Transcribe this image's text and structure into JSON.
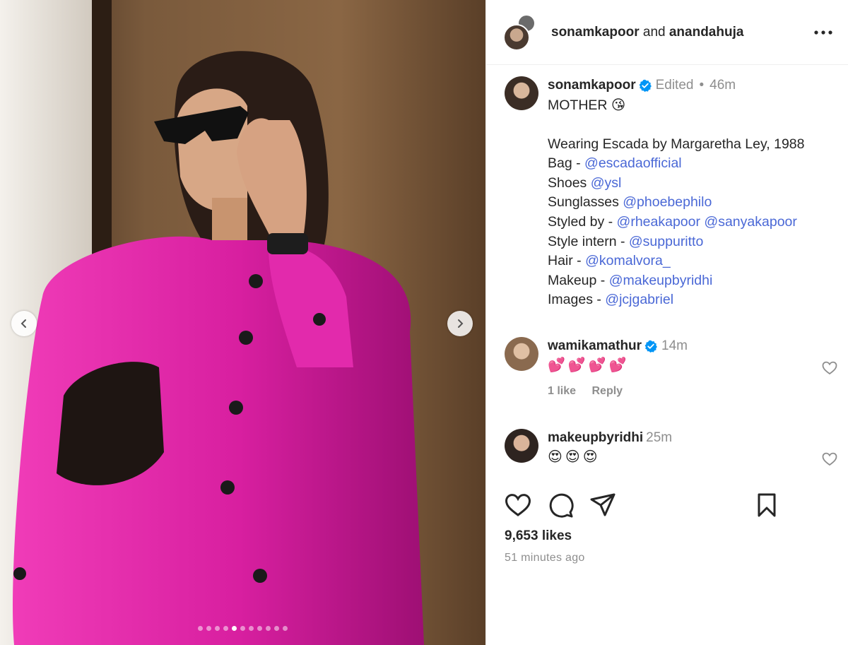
{
  "header": {
    "user1": "sonamkapoor",
    "joiner": "and",
    "user2": "anandahuja"
  },
  "post": {
    "author": "sonamkapoor",
    "edited": "Edited",
    "separator": "•",
    "time": "46m",
    "caption_title": "MOTHER 😘",
    "caption_lines": [
      {
        "prefix": "Wearing Escada by Margaretha Ley, 1988",
        "mentions": []
      },
      {
        "prefix": "Bag - ",
        "mentions": [
          "@escadaofficial"
        ]
      },
      {
        "prefix": "Shoes ",
        "mentions": [
          "@ysl"
        ]
      },
      {
        "prefix": "Sunglasses ",
        "mentions": [
          "@phoebephilo"
        ]
      },
      {
        "prefix": "Styled by - ",
        "mentions": [
          "@rheakapoor",
          "@sanyakapoor"
        ]
      },
      {
        "prefix": "Style intern - ",
        "mentions": [
          "@suppuritto"
        ]
      },
      {
        "prefix": "Hair - ",
        "mentions": [
          "@komalvora_"
        ]
      },
      {
        "prefix": "Makeup - ",
        "mentions": [
          "@makeupbyridhi"
        ]
      },
      {
        "prefix": "Images - ",
        "mentions": [
          "@jcjgabriel"
        ]
      }
    ]
  },
  "comments": [
    {
      "username": "wamikamathur",
      "time": "14m",
      "text": "💕💕💕💕",
      "likes": "1 like",
      "reply": "Reply"
    },
    {
      "username": "makeupbyridhi",
      "time": "25m",
      "text": "😍😍😍"
    }
  ],
  "footer": {
    "likes": "9,653 likes",
    "time_ago": "51 minutes ago"
  },
  "carousel": {
    "total": 11,
    "active_index": 4
  },
  "colors": {
    "mention": "#4a68d6",
    "verified": "#0095f6",
    "muted": "#8e8e8e",
    "jacket": "#d81fa0"
  },
  "icons": [
    "chevron-left-icon",
    "chevron-right-icon",
    "more-icon",
    "verified-icon",
    "heart-icon",
    "comment-icon",
    "share-icon",
    "bookmark-icon"
  ]
}
